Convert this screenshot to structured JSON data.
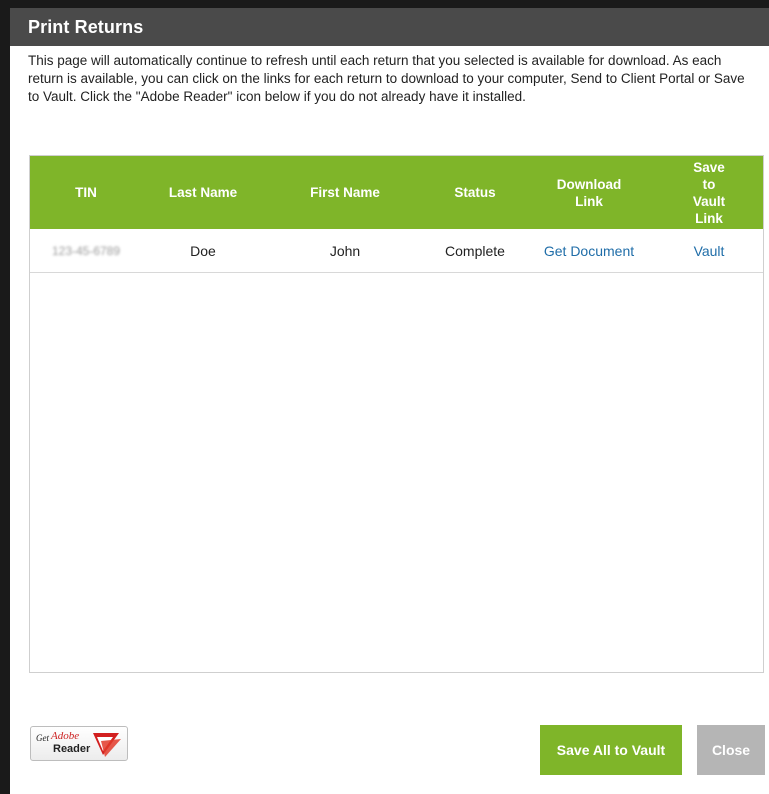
{
  "dialog": {
    "title": "Print Returns",
    "intro": "This page will automatically continue to refresh until each return that you selected is available for download.  As each return is available, you can click on the links for each return to download to your computer, Send to Client Portal or Save to Vault.  Click the \"Adobe Reader\" icon below if you do not already have it installed."
  },
  "table": {
    "headers": {
      "tin": "TIN",
      "last_name": "Last Name",
      "first_name": "First Name",
      "status": "Status",
      "download_link": "Download Link",
      "vault_link": "Save to Vault Link"
    },
    "rows": [
      {
        "tin": "123-45-6789",
        "last_name": "Doe",
        "first_name": "John",
        "status": "Complete",
        "download": "Get Document",
        "vault": "Vault"
      }
    ]
  },
  "footer": {
    "adobe": {
      "get": "Get",
      "brand": "Adobe",
      "product": "Reader"
    },
    "save_all_label": "Save All to Vault",
    "close_label": "Close"
  },
  "colors": {
    "header_green": "#7fb529",
    "title_bar": "#4a4a4a",
    "link_blue": "#1f6da8",
    "close_gray": "#b5b5b5"
  }
}
